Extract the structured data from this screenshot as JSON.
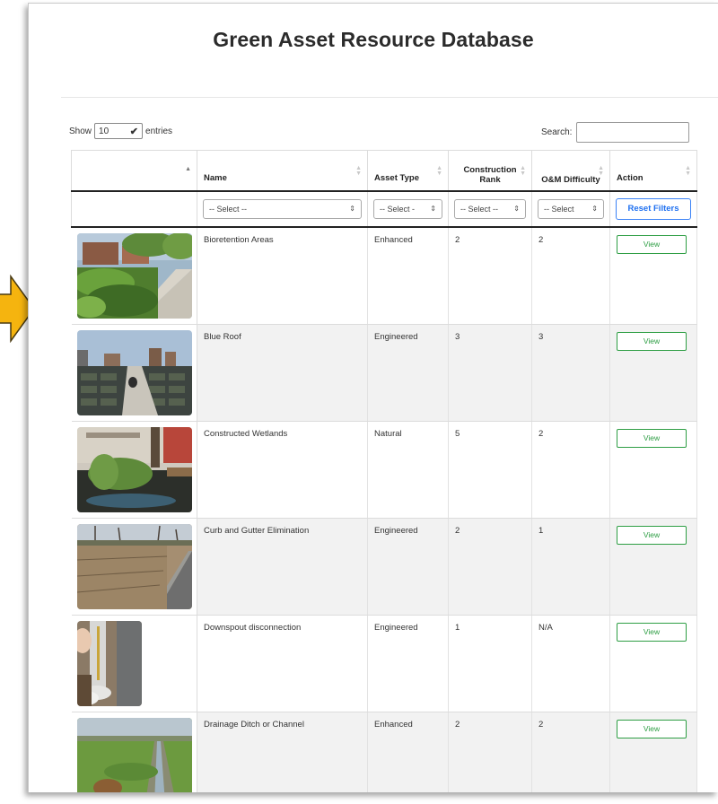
{
  "page": {
    "title": "Green Asset Resource Database"
  },
  "length_control": {
    "prefix": "Show",
    "value": "10",
    "suffix": "entries"
  },
  "search": {
    "label": "Search:",
    "value": ""
  },
  "table": {
    "headers": [
      "Name",
      "Asset Type",
      "Construction Rank",
      "O&M Difficulty",
      "Action"
    ],
    "filters": {
      "name": "-- Select --",
      "asset_type": "-- Select -",
      "construction_rank": "-- Select --",
      "om_difficulty": "-- Select",
      "reset_label": "Reset Filters"
    },
    "rows": [
      {
        "name": "Bioretention Areas",
        "asset_type": "Enhanced",
        "construction_rank": "2",
        "om_difficulty": "2",
        "action": "View",
        "photo": "bioretention-photo"
      },
      {
        "name": "Blue Roof",
        "asset_type": "Engineered",
        "construction_rank": "3",
        "om_difficulty": "3",
        "action": "View",
        "photo": "blue-roof-photo"
      },
      {
        "name": "Constructed Wetlands",
        "asset_type": "Natural",
        "construction_rank": "5",
        "om_difficulty": "2",
        "action": "View",
        "photo": "wetlands-photo"
      },
      {
        "name": "Curb and Gutter Elimination",
        "asset_type": "Engineered",
        "construction_rank": "2",
        "om_difficulty": "1",
        "action": "View",
        "photo": "curb-gutter-photo"
      },
      {
        "name": "Downspout disconnection",
        "asset_type": "Engineered",
        "construction_rank": "1",
        "om_difficulty": "N/A",
        "action": "View",
        "photo": "downspout-photo"
      },
      {
        "name": "Drainage Ditch or Channel",
        "asset_type": "Enhanced",
        "construction_rank": "2",
        "om_difficulty": "2",
        "action": "View",
        "photo": "drainage-ditch-photo"
      }
    ]
  },
  "colors": {
    "view_button": "#2e9e44",
    "reset_button": "#1d6ff0",
    "pointer_arrow": "#f5b40f"
  }
}
